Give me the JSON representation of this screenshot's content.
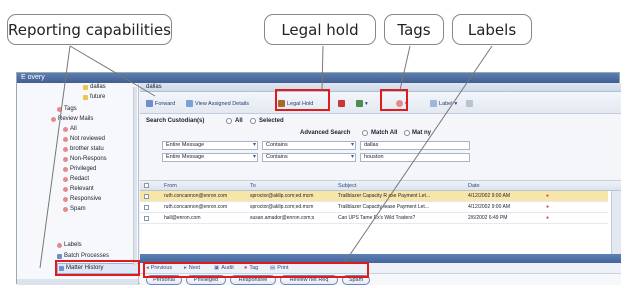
{
  "callouts": {
    "reporting": "Reporting capabilities",
    "legal_hold": "Legal hold",
    "tags": "Tags",
    "labels": "Labels"
  },
  "app": {
    "title": "E  overy",
    "crumb": "dallas"
  },
  "sidebar": {
    "items": [
      {
        "label": "dallas",
        "icon": "folder-icon"
      },
      {
        "label": "future",
        "icon": "folder-icon"
      },
      {
        "label": "Tags",
        "icon": "tag-icon"
      },
      {
        "label": "Review Mails",
        "icon": "tag-icon"
      },
      {
        "label": "All",
        "icon": "tag-icon"
      },
      {
        "label": "Not reviewed",
        "icon": "tag-icon"
      },
      {
        "label": "brother statu",
        "icon": "tag-icon"
      },
      {
        "label": "Non-Respons",
        "icon": "tag-icon"
      },
      {
        "label": "Privileged",
        "icon": "tag-icon"
      },
      {
        "label": "Redact",
        "icon": "tag-icon"
      },
      {
        "label": "Relevant",
        "icon": "tag-icon"
      },
      {
        "label": "Responsive",
        "icon": "tag-icon"
      },
      {
        "label": "Spam",
        "icon": "tag-icon"
      },
      {
        "label": "Labels",
        "icon": "tag-icon"
      },
      {
        "label": "Batch Processes",
        "icon": "batch-icon"
      },
      {
        "label": "Matter History",
        "icon": "history-icon"
      }
    ]
  },
  "toolbar": {
    "forward": "Forward",
    "view_assigned": "View Assigned Details",
    "legal_hold": "Legal Hold",
    "label": "Label"
  },
  "search": {
    "custodian_label": "Search Custodian(s)",
    "all": "All",
    "selected": "Selected",
    "advanced": "Advanced Search",
    "match_all": "Match All",
    "match_any": "Mat  ny",
    "rows": [
      {
        "field": "Entire Message",
        "op": "Contains",
        "value": "dallas"
      },
      {
        "field": "Entire Message",
        "op": "Contains",
        "value": "houston"
      }
    ]
  },
  "grid": {
    "headers": [
      "From",
      "To",
      "Subject",
      "Date"
    ],
    "rows": [
      {
        "from": "ruth.concannon@enron.com",
        "to": "sproctor@akllp.com;ed.mcm",
        "subject": "Trailblazer Capacity R  ase Payment Let...",
        "date": "4/12/2002 9:00 AM"
      },
      {
        "from": "ruth.concannon@enron.com",
        "to": "sproctor@akllp.com;ed.mcm",
        "subject": "Trailblazer Capacity   lease Payment Let...",
        "date": "4/12/2002 9:00 AM"
      },
      {
        "from": "hall@enron.com",
        "to": "susan.amador@enron.com;s",
        "subject": "Can UPS Tame  Ex's Wild Traders?",
        "date": "2/6/2002 6:49 PM"
      }
    ]
  },
  "actions": {
    "previous": "Previous",
    "next": "Next",
    "audit": "Audit",
    "tag": "Tag",
    "print": "Print"
  },
  "labels": [
    "Personal",
    "Privileged",
    "Responsive",
    "Review net Req",
    "Spam"
  ],
  "colors": {
    "highlight_box": "#e01b1b",
    "selected_row": "#f8e6a8",
    "chrome_blue": "#44659b"
  }
}
